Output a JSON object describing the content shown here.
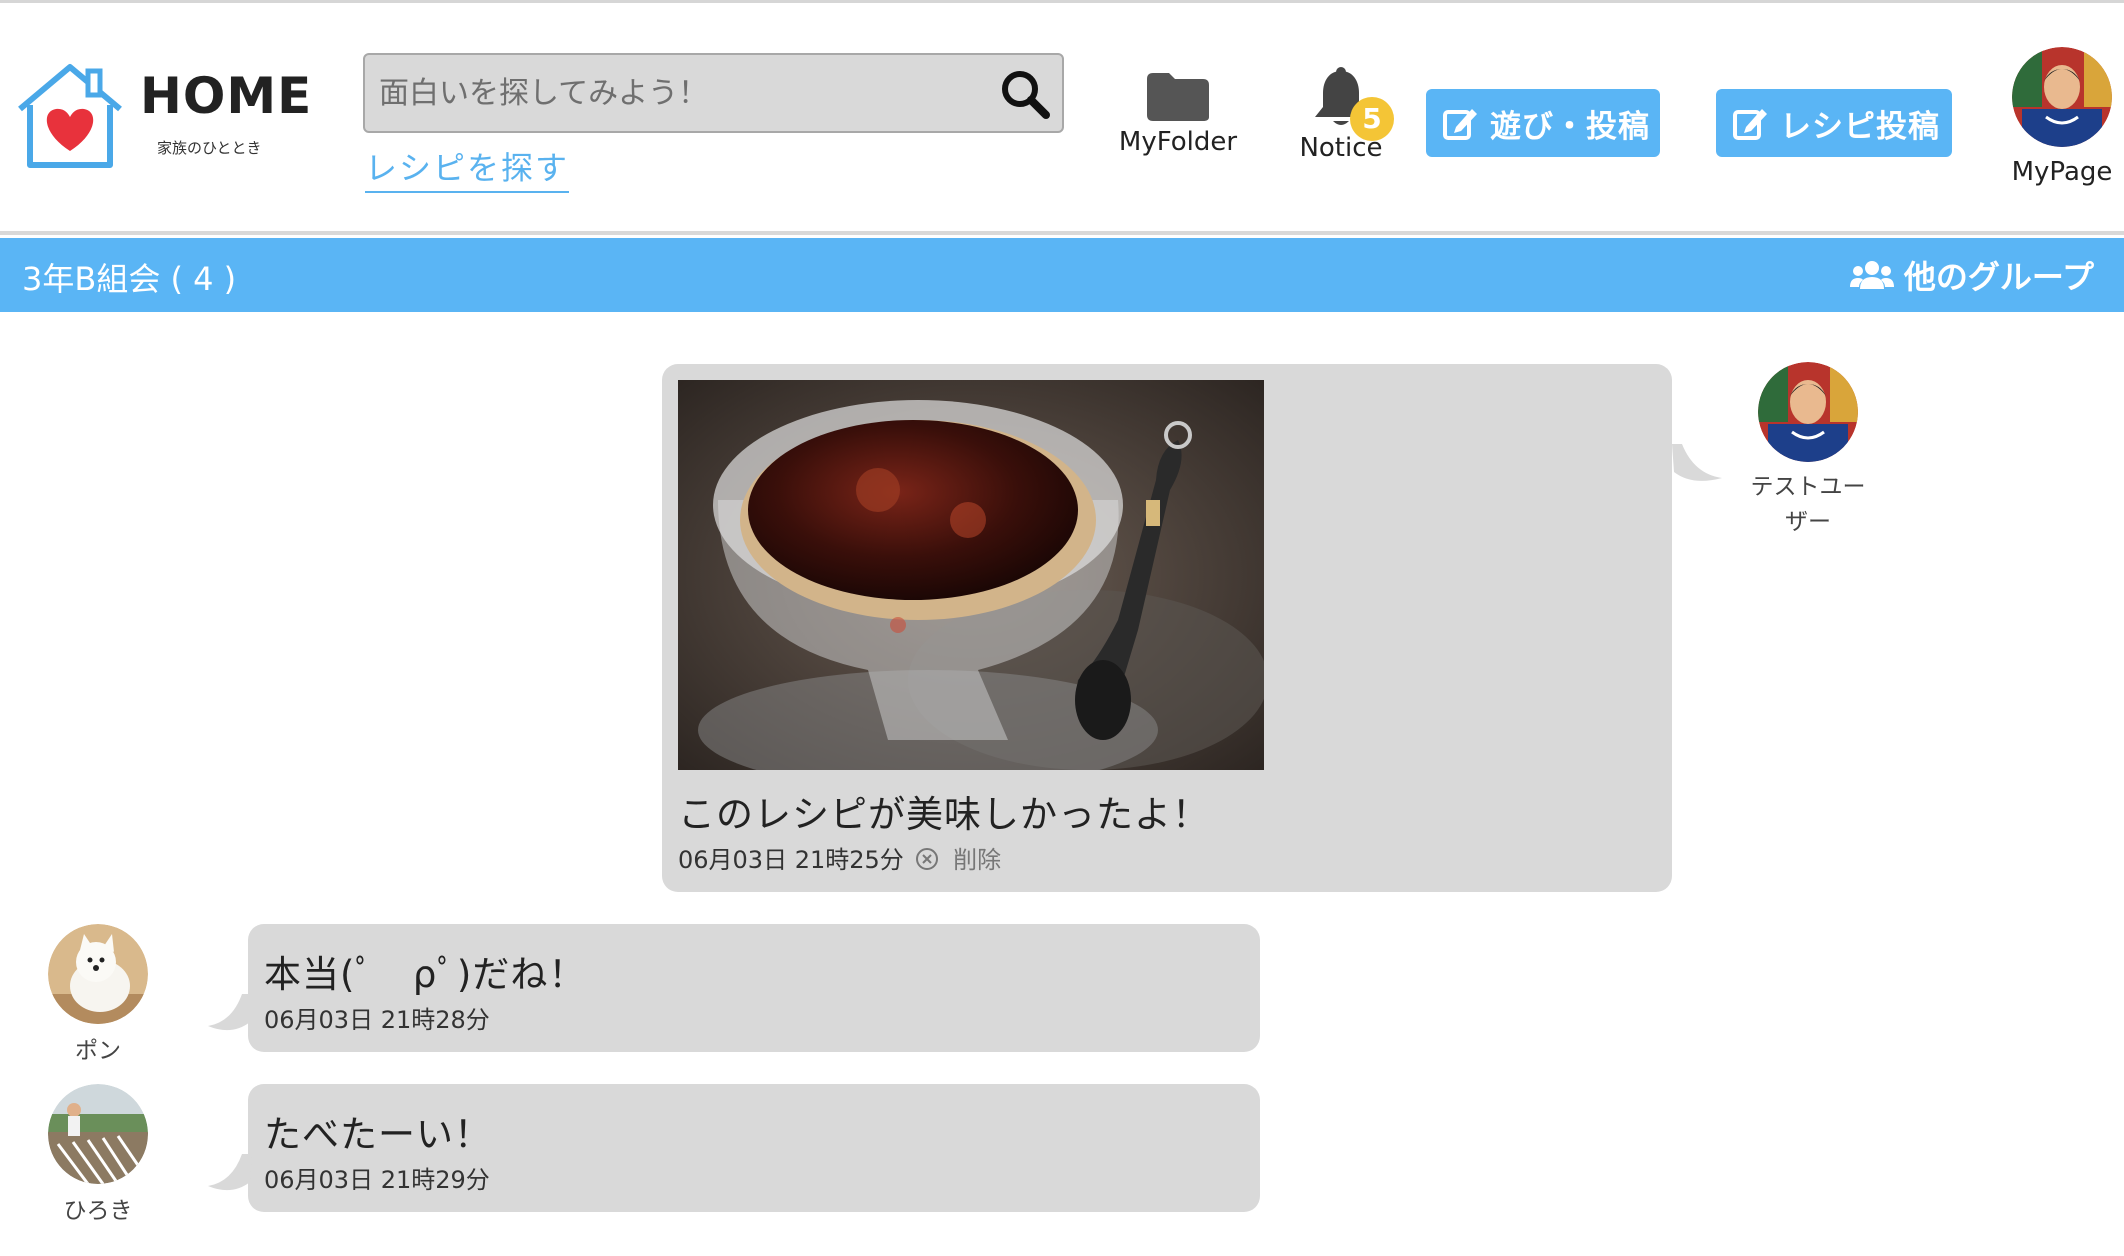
{
  "logo": {
    "title": "HOME",
    "subtitle": "家族のひととき",
    "icon": "house-heart-icon"
  },
  "search": {
    "placeholder": "面白いを探してみよう！",
    "link_label": "レシピを探す"
  },
  "nav": {
    "folder_label": "MyFolder",
    "notice_label": "Notice",
    "notice_count": "5",
    "play_post_label": "遊び・投稿",
    "recipe_post_label": "レシピ投稿",
    "mypage_label": "MyPage"
  },
  "group": {
    "title": "3年B組会 ( 4 )",
    "other_groups_label": "他のグループ"
  },
  "messages": [
    {
      "user": "テストユー\nザー",
      "user_line1": "テストユー",
      "user_line2": "ザー",
      "text": "このレシピが美味しかったよ！",
      "time": "06月03日 21時25分",
      "delete_label": "削除",
      "image": "coffee-jelly-photo"
    },
    {
      "user": "ポン",
      "text": "本当(ﾟ　ρﾟ)だね！",
      "time": "06月03日 21時28分"
    },
    {
      "user": "ひろき",
      "text": "たべたーい！",
      "time": "06月03日 21時29分"
    }
  ],
  "colors": {
    "accent": "#5ab5f5",
    "bubble": "#d9d9d9",
    "badge": "#f4c536",
    "heart": "#e8323c"
  }
}
